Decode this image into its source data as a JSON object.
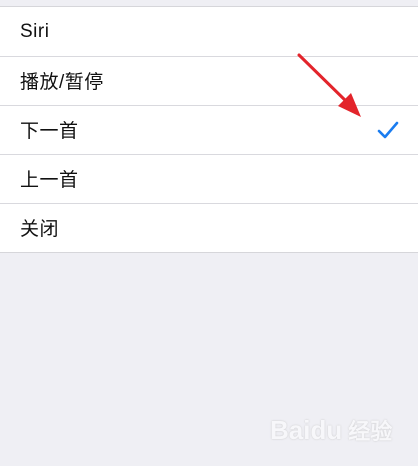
{
  "menu": {
    "items": [
      {
        "label": "Siri",
        "selected": false
      },
      {
        "label": "播放/暂停",
        "selected": false
      },
      {
        "label": "下一首",
        "selected": true
      },
      {
        "label": "上一首",
        "selected": false
      },
      {
        "label": "关闭",
        "selected": false
      }
    ]
  },
  "colors": {
    "check": "#1a7cf0",
    "arrow": "#e3242b",
    "background": "#efeff4",
    "list_background": "#ffffff"
  },
  "icons": {
    "check": "checkmark-icon",
    "annotation": "red-arrow-annotation",
    "watermark": "baidu-jingyan-logo"
  },
  "watermark": {
    "brand": "Bai",
    "brand_paw": "du",
    "cn": "经验"
  }
}
